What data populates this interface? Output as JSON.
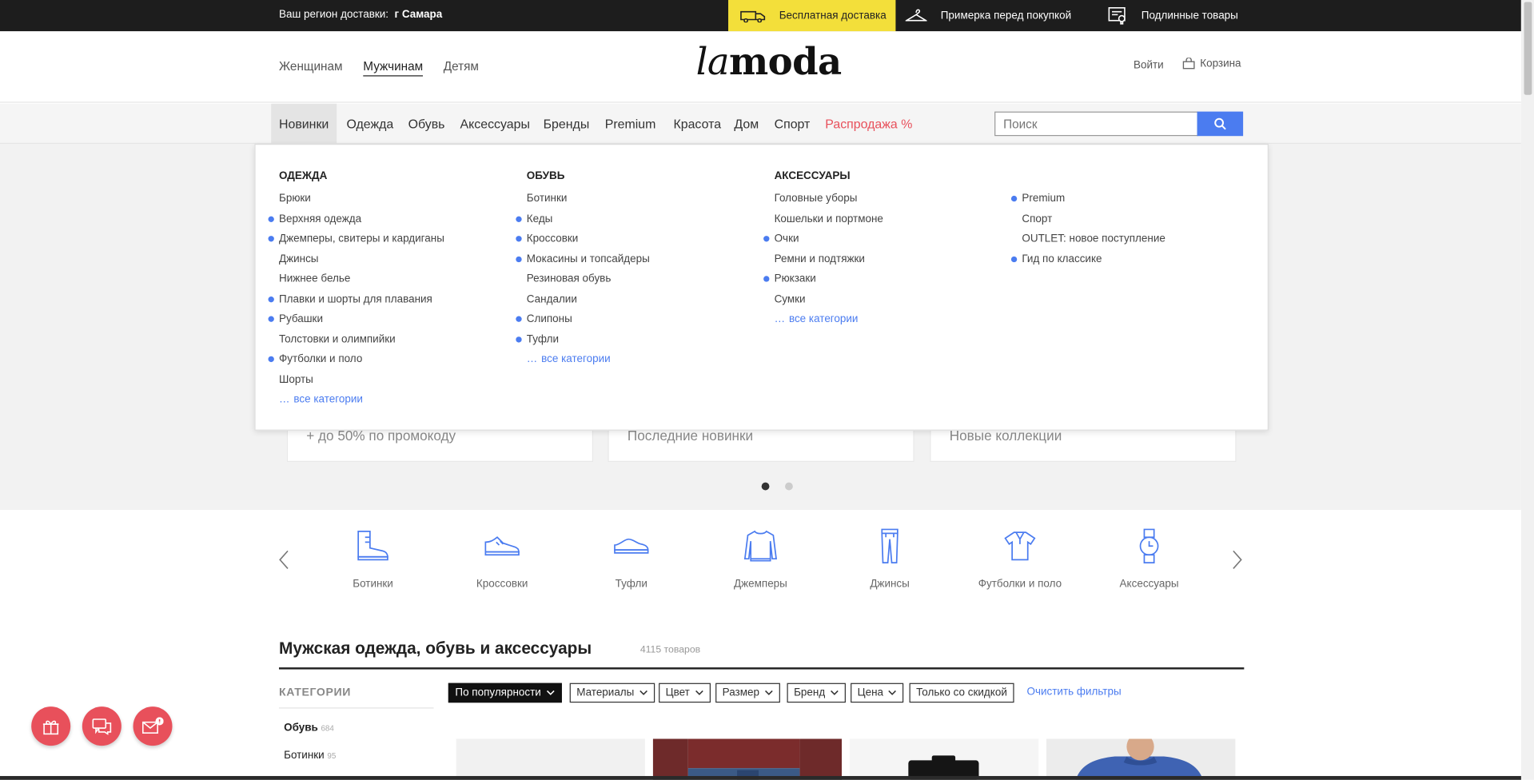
{
  "topbar": {
    "region_label": "Ваш регион доставки:",
    "region_value": "г Самара",
    "promo_shipping": "Бесплатная доставка",
    "promo_fitting": "Примерка перед покупкой",
    "promo_original": "Подлинные товары"
  },
  "header": {
    "genders": [
      "Женщинам",
      "Мужчинам",
      "Детям"
    ],
    "active_gender": "Мужчинам",
    "logo_italic": "la",
    "logo_bold": "moda",
    "login": "Войти",
    "cart": "Корзина"
  },
  "nav": {
    "items": [
      "Новинки",
      "Одежда",
      "Обувь",
      "Аксессуары",
      "Бренды",
      "Premium",
      "Красота",
      "Дом",
      "Спорт",
      "Распродажа %"
    ],
    "active": "Новинки",
    "search_placeholder": "Поиск"
  },
  "mega_menu": {
    "clothing": {
      "title": "ОДЕЖДА",
      "items": [
        {
          "label": "Брюки",
          "dot": false
        },
        {
          "label": "Верхняя одежда",
          "dot": true
        },
        {
          "label": "Джемперы, свитеры и кардиганы",
          "dot": true
        },
        {
          "label": "Джинсы",
          "dot": false
        },
        {
          "label": "Нижнее белье",
          "dot": false
        },
        {
          "label": "Плавки и шорты для плавания",
          "dot": true
        },
        {
          "label": "Рубашки",
          "dot": true
        },
        {
          "label": "Толстовки и олимпийки",
          "dot": false
        },
        {
          "label": "Футболки и поло",
          "dot": true
        },
        {
          "label": "Шорты",
          "dot": false
        }
      ],
      "all": "все категории"
    },
    "shoes": {
      "title": "ОБУВЬ",
      "items": [
        {
          "label": "Ботинки",
          "dot": false
        },
        {
          "label": "Кеды",
          "dot": true
        },
        {
          "label": "Кроссовки",
          "dot": true
        },
        {
          "label": "Мокасины и топсайдеры",
          "dot": true
        },
        {
          "label": "Резиновая обувь",
          "dot": false
        },
        {
          "label": "Сандалии",
          "dot": false
        },
        {
          "label": "Слипоны",
          "dot": true
        },
        {
          "label": "Туфли",
          "dot": true
        }
      ],
      "all": "все категории"
    },
    "accessories": {
      "title": "АКСЕССУАРЫ",
      "items": [
        {
          "label": "Головные уборы",
          "dot": false
        },
        {
          "label": "Кошельки и портмоне",
          "dot": false
        },
        {
          "label": "Очки",
          "dot": true
        },
        {
          "label": "Ремни и подтяжки",
          "dot": false
        },
        {
          "label": "Рюкзаки",
          "dot": true
        },
        {
          "label": "Сумки",
          "dot": false
        }
      ],
      "all": "все категории"
    },
    "extra": {
      "items": [
        {
          "label": "Premium",
          "dot": true
        },
        {
          "label": "Спорт",
          "dot": false
        },
        {
          "label": "OUTLET: новое поступление",
          "dot": false
        },
        {
          "label": "Гид по классике",
          "dot": true
        }
      ]
    }
  },
  "banners": {
    "cards": [
      "+ до 50% по промокоду",
      "Последние новинки",
      "Новые коллекции"
    ],
    "active_slide": 1,
    "slides_total": 2
  },
  "categories_strip": {
    "items": [
      {
        "label": "Ботинки",
        "icon": "boot-icon"
      },
      {
        "label": "Кроссовки",
        "icon": "sneaker-icon"
      },
      {
        "label": "Туфли",
        "icon": "shoe-icon"
      },
      {
        "label": "Джемперы",
        "icon": "sweater-icon"
      },
      {
        "label": "Джинсы",
        "icon": "jeans-icon"
      },
      {
        "label": "Футболки и поло",
        "icon": "polo-icon"
      },
      {
        "label": "Аксессуары",
        "icon": "watch-icon"
      }
    ]
  },
  "listing": {
    "title": "Мужская одежда, обувь и аксессуары",
    "count": "4115 товаров",
    "categories_title": "КАТЕГОРИИ",
    "sidebar": [
      {
        "label": "Обувь",
        "count": "684",
        "bold": true
      },
      {
        "label": "Ботинки",
        "count": "95",
        "bold": false
      }
    ],
    "filters": [
      "По популярности",
      "Материалы",
      "Цвет",
      "Размер",
      "Бренд",
      "Цена"
    ],
    "discount_filter": "Только со скидкой",
    "clear_filters": "Очистить фильтры"
  },
  "colors": {
    "accent_blue": "#4b7cf0",
    "sale_red": "#e8505b",
    "promo_yellow": "#f3df3a",
    "topbar_dark": "#1d1d1d"
  }
}
